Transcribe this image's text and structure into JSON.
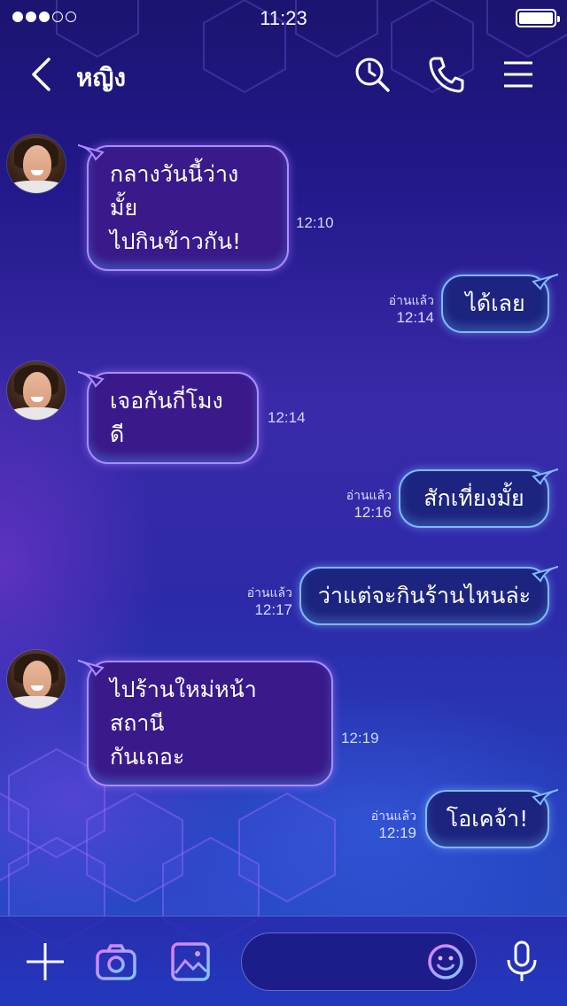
{
  "status_bar": {
    "time": "11:23",
    "signal_total": 5,
    "signal_on": 3,
    "battery_level": 1.0
  },
  "header": {
    "contact_name": "หญิง",
    "icons": [
      "back-chevron-icon",
      "search-history-icon",
      "phone-icon",
      "menu-icon"
    ]
  },
  "messages": [
    {
      "side": "in",
      "lines": [
        "กลางวันนี้ว่างมั้ย",
        "ไปกินข้าวกัน!"
      ],
      "time": "12:10"
    },
    {
      "side": "out",
      "lines": [
        "ได้เลย"
      ],
      "read": "อ่านแล้ว",
      "time": "12:14"
    },
    {
      "side": "in",
      "lines": [
        "เจอกันกี่โมงดี"
      ],
      "time": "12:14"
    },
    {
      "side": "out",
      "lines": [
        "สักเที่ยงมั้ย"
      ],
      "read": "อ่านแล้ว",
      "time": "12:16"
    },
    {
      "side": "out",
      "lines": [
        "ว่าแต่จะกินร้านไหนล่ะ"
      ],
      "read": "อ่านแล้ว",
      "time": "12:17"
    },
    {
      "side": "in",
      "lines": [
        "ไปร้านใหม่หน้าสถานี",
        "กันเถอะ"
      ],
      "time": "12:19"
    },
    {
      "side": "out",
      "lines": [
        "โอเคจ้า!"
      ],
      "read": "อ่านแล้ว",
      "time": "12:19"
    }
  ],
  "bottom_bar": {
    "icons": [
      "plus-icon",
      "camera-icon",
      "image-icon",
      "emoji-icon",
      "microphone-icon"
    ],
    "input_value": "",
    "input_placeholder": ""
  },
  "colors": {
    "accent_pink": "#c86bff",
    "accent_blue": "#6fc2ff",
    "bubble_in": "#3a1a8a",
    "bubble_out": "#1c2480"
  }
}
